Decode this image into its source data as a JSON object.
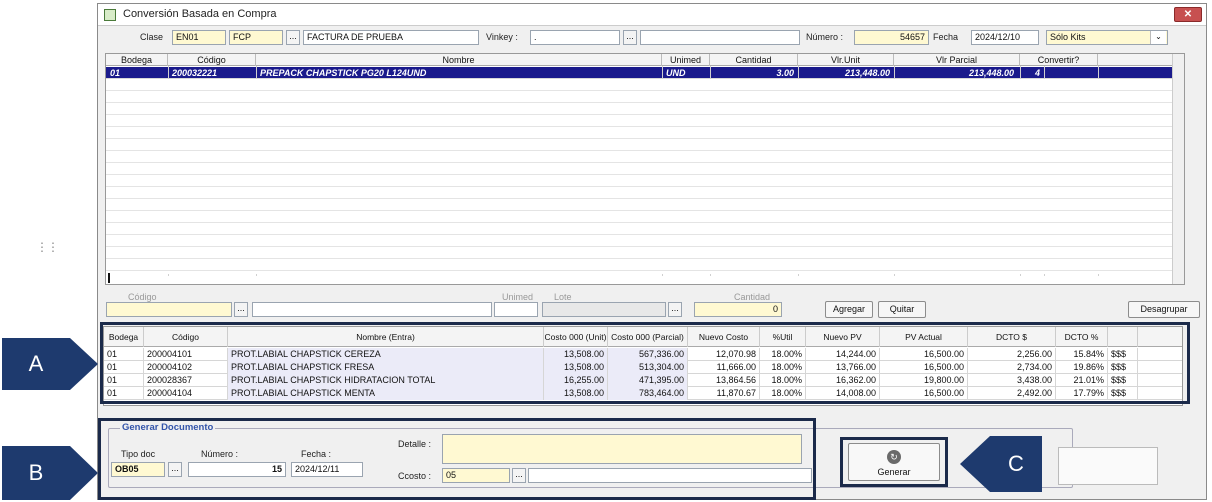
{
  "window": {
    "title": "Conversión Basada en Compra",
    "close_label": "✕"
  },
  "header": {
    "clase_label": "Clase",
    "clase_value": "EN01",
    "tipo_value": "FCP",
    "descripcion_value": "FACTURA DE PRUEBA",
    "vinkey_label": "Vinkey :",
    "vinkey_value": ".",
    "numero_label": "Número :",
    "numero_value": "54657",
    "fecha_label": "Fecha",
    "fecha_value": "2024/12/10",
    "kits_value": "Sólo Kits"
  },
  "grid_top": {
    "columns": [
      "Bodega",
      "Código",
      "Nombre",
      "Unimed",
      "Cantidad",
      "Vlr.Unit",
      "Vlr Parcial",
      "Convertir?"
    ],
    "row": {
      "bodega": "01",
      "codigo": "200032221",
      "nombre": "PREPACK CHAPSTICK PG20 L124UND",
      "unimed": "UND",
      "cantidad": "3.00",
      "vlr_unit": "213,448.00",
      "vlr_parcial": "213,448.00",
      "convertir": "4"
    }
  },
  "entry": {
    "codigo_label": "Código",
    "unimed_label": "Unimed",
    "lote_label": "Lote",
    "cantidad_label": "Cantidad",
    "cantidad_value": "0",
    "agregar_label": "Agregar",
    "quitar_label": "Quitar",
    "desagrupar_label": "Desagrupar"
  },
  "grid_bottom": {
    "columns": [
      "Bodega",
      "Código",
      "Nombre (Entra)",
      "Costo 000 (Unit)",
      "Costo 000 (Parcial)",
      "Nuevo Costo",
      "%Util",
      "Nuevo PV",
      "PV Actual",
      "DCTO $",
      "DCTO %"
    ],
    "rows": [
      {
        "bodega": "01",
        "codigo": "200004101",
        "nombre": "PROT.LABIAL CHAPSTICK CEREZA",
        "costo_unit": "13,508.00",
        "costo_parcial": "567,336.00",
        "nuevo_costo": "12,070.98",
        "util": "18.00%",
        "nuevo_pv": "14,244.00",
        "pv_actual": "16,500.00",
        "dcto": "2,256.00",
        "dcto_pct": "15.84%",
        "extra": "$$$"
      },
      {
        "bodega": "01",
        "codigo": "200004102",
        "nombre": "PROT.LABIAL CHAPSTICK FRESA",
        "costo_unit": "13,508.00",
        "costo_parcial": "513,304.00",
        "nuevo_costo": "11,666.00",
        "util": "18.00%",
        "nuevo_pv": "13,766.00",
        "pv_actual": "16,500.00",
        "dcto": "2,734.00",
        "dcto_pct": "19.86%",
        "extra": "$$$"
      },
      {
        "bodega": "01",
        "codigo": "200028367",
        "nombre": "PROT.LABIAL CHAPSTICK HIDRATACION TOTAL",
        "costo_unit": "16,255.00",
        "costo_parcial": "471,395.00",
        "nuevo_costo": "13,864.56",
        "util": "18.00%",
        "nuevo_pv": "16,362.00",
        "pv_actual": "19,800.00",
        "dcto": "3,438.00",
        "dcto_pct": "21.01%",
        "extra": "$$$"
      },
      {
        "bodega": "01",
        "codigo": "200004104",
        "nombre": "PROT.LABIAL CHAPSTICK MENTA",
        "costo_unit": "13,508.00",
        "costo_parcial": "783,464.00",
        "nuevo_costo": "11,870.67",
        "util": "18.00%",
        "nuevo_pv": "14,008.00",
        "pv_actual": "16,500.00",
        "dcto": "2,492.00",
        "dcto_pct": "17.79%",
        "extra": "$$$"
      }
    ]
  },
  "generar": {
    "group_title": "Generar Documento",
    "tipo_doc_label": "Tipo doc",
    "tipo_doc_value": "OB05",
    "numero_label": "Número :",
    "numero_value": "15",
    "fecha_label": "Fecha :",
    "fecha_value": "2024/12/11",
    "detalle_label": "Detalle :",
    "ccosto_label": "Ccosto :",
    "ccosto_value": "05",
    "button_label": "Generar"
  },
  "callouts": {
    "a": "A",
    "b": "B",
    "c": "C"
  },
  "colors": {
    "selected_row": "#1a1a8c",
    "callout": "#1e3a6e",
    "frame": "#1b2a4a",
    "input_yellow": "#fff9d2"
  }
}
